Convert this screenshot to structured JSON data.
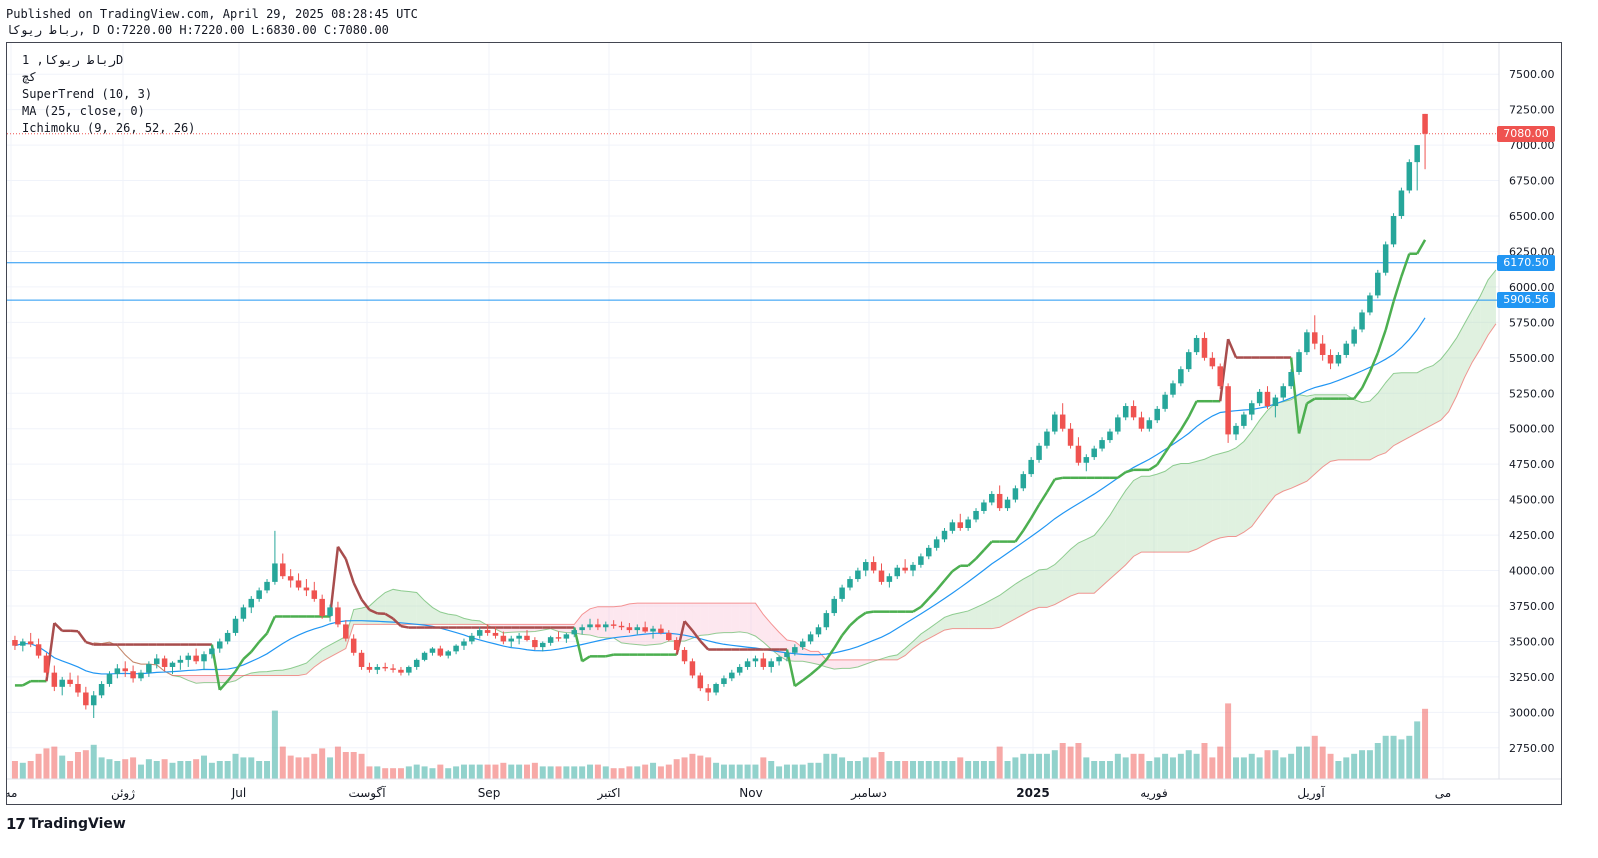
{
  "header": {
    "published": "Published on TradingView.com, April 29, 2025 08:28:45 UTC",
    "ohlc_line": "رباط ریوکا, D O:7220.00 H:7220.00 L:6830.00 C:7080.00"
  },
  "legend": {
    "symbol_line": "رباط ریوکا, 1D",
    "sub_symbol": "کچ",
    "indicator_1": "SuperTrend (10, 3)",
    "indicator_2": "MA (25, close, 0)",
    "indicator_3": "Ichimoku (9, 26, 52, 26)"
  },
  "price_tags": [
    {
      "label": "7080.00",
      "value": 7080,
      "color": "#ef5350"
    },
    {
      "label": "6170.50",
      "value": 6170.5,
      "color": "#2196f3"
    },
    {
      "label": "5906.56",
      "value": 5906.56,
      "color": "#2196f3"
    }
  ],
  "logo": {
    "mark": "17",
    "text": "TradingView"
  },
  "colors": {
    "up": "#26a69a",
    "down": "#ef5350",
    "supertrend_up": "#4caf50",
    "supertrend_down": "#a84d4d",
    "ma": "#2196f3",
    "cloud_green": "#a5d6a7",
    "cloud_red": "#f8bbd0",
    "hline": "#2196f3"
  },
  "chart_data": {
    "type": "candlestick",
    "y_axis_ticks": [
      "7500.00",
      "7250.00",
      "7000.00",
      "6750.00",
      "6500.00",
      "6250.00",
      "6000.00",
      "5750.00",
      "5500.00",
      "5250.00",
      "5000.00",
      "4750.00",
      "4500.00",
      "4250.00",
      "4000.00",
      "3750.00",
      "3500.00",
      "3250.00",
      "3000.00",
      "2750.00"
    ],
    "ylim": [
      2530,
      7720
    ],
    "x_axis_labels": [
      "مه",
      "ژوئن",
      "Jul",
      "آگوست",
      "Sep",
      "اکتبر",
      "Nov",
      "دسامبر",
      "2025",
      "فوریه",
      "آوریل",
      "می"
    ],
    "horizontal_lines": [
      6170.5,
      5906.56
    ],
    "last_close": 7080,
    "sessions": 180,
    "candles": [
      [
        3510,
        3540,
        3440,
        3470
      ],
      [
        3470,
        3520,
        3430,
        3500
      ],
      [
        3500,
        3560,
        3460,
        3480
      ],
      [
        3480,
        3520,
        3380,
        3400
      ],
      [
        3400,
        3420,
        3250,
        3280
      ],
      [
        3280,
        3330,
        3150,
        3180
      ],
      [
        3180,
        3250,
        3120,
        3230
      ],
      [
        3230,
        3280,
        3180,
        3200
      ],
      [
        3200,
        3260,
        3110,
        3140
      ],
      [
        3140,
        3180,
        3020,
        3050
      ],
      [
        3050,
        3150,
        2960,
        3120
      ],
      [
        3120,
        3220,
        3100,
        3200
      ],
      [
        3200,
        3290,
        3180,
        3270
      ],
      [
        3270,
        3340,
        3240,
        3310
      ],
      [
        3310,
        3360,
        3250,
        3290
      ],
      [
        3290,
        3330,
        3210,
        3240
      ],
      [
        3240,
        3300,
        3220,
        3280
      ],
      [
        3280,
        3360,
        3250,
        3340
      ],
      [
        3340,
        3410,
        3310,
        3380
      ],
      [
        3380,
        3400,
        3290,
        3320
      ],
      [
        3320,
        3360,
        3270,
        3350
      ],
      [
        3350,
        3400,
        3300,
        3370
      ],
      [
        3370,
        3420,
        3320,
        3400
      ],
      [
        3400,
        3450,
        3340,
        3360
      ],
      [
        3360,
        3430,
        3300,
        3410
      ],
      [
        3410,
        3470,
        3380,
        3450
      ],
      [
        3450,
        3520,
        3420,
        3500
      ],
      [
        3500,
        3580,
        3480,
        3560
      ],
      [
        3560,
        3680,
        3540,
        3660
      ],
      [
        3660,
        3760,
        3640,
        3740
      ],
      [
        3740,
        3820,
        3700,
        3800
      ],
      [
        3800,
        3880,
        3780,
        3860
      ],
      [
        3860,
        3940,
        3840,
        3920
      ],
      [
        3920,
        4280,
        3900,
        4050
      ],
      [
        4050,
        4120,
        3940,
        3960
      ],
      [
        3960,
        4010,
        3880,
        3930
      ],
      [
        3930,
        3980,
        3860,
        3880
      ],
      [
        3880,
        3940,
        3820,
        3860
      ],
      [
        3860,
        3920,
        3780,
        3800
      ],
      [
        3800,
        3830,
        3660,
        3680
      ],
      [
        3680,
        3760,
        3640,
        3740
      ],
      [
        3740,
        3780,
        3600,
        3620
      ],
      [
        3620,
        3650,
        3500,
        3520
      ],
      [
        3520,
        3550,
        3400,
        3420
      ],
      [
        3420,
        3440,
        3300,
        3320
      ],
      [
        3320,
        3350,
        3280,
        3300
      ],
      [
        3300,
        3340,
        3270,
        3320
      ],
      [
        3320,
        3350,
        3290,
        3310
      ],
      [
        3310,
        3340,
        3280,
        3300
      ],
      [
        3300,
        3320,
        3260,
        3280
      ],
      [
        3280,
        3330,
        3260,
        3320
      ],
      [
        3320,
        3380,
        3300,
        3370
      ],
      [
        3370,
        3430,
        3360,
        3420
      ],
      [
        3420,
        3460,
        3400,
        3450
      ],
      [
        3450,
        3470,
        3390,
        3400
      ],
      [
        3400,
        3440,
        3380,
        3430
      ],
      [
        3430,
        3480,
        3410,
        3470
      ],
      [
        3470,
        3520,
        3440,
        3500
      ],
      [
        3500,
        3560,
        3480,
        3540
      ],
      [
        3540,
        3600,
        3520,
        3580
      ],
      [
        3580,
        3620,
        3540,
        3560
      ],
      [
        3560,
        3600,
        3520,
        3540
      ],
      [
        3540,
        3570,
        3480,
        3500
      ],
      [
        3500,
        3540,
        3460,
        3520
      ],
      [
        3520,
        3560,
        3480,
        3540
      ],
      [
        3540,
        3580,
        3500,
        3510
      ],
      [
        3510,
        3530,
        3440,
        3460
      ],
      [
        3460,
        3500,
        3430,
        3490
      ],
      [
        3490,
        3540,
        3470,
        3530
      ],
      [
        3530,
        3570,
        3500,
        3520
      ],
      [
        3520,
        3560,
        3490,
        3550
      ],
      [
        3550,
        3600,
        3530,
        3580
      ],
      [
        3580,
        3620,
        3550,
        3600
      ],
      [
        3600,
        3660,
        3580,
        3620
      ],
      [
        3620,
        3660,
        3580,
        3600
      ],
      [
        3600,
        3640,
        3570,
        3620
      ],
      [
        3620,
        3650,
        3590,
        3610
      ],
      [
        3610,
        3640,
        3580,
        3600
      ],
      [
        3600,
        3630,
        3560,
        3580
      ],
      [
        3580,
        3620,
        3550,
        3600
      ],
      [
        3600,
        3640,
        3560,
        3570
      ],
      [
        3570,
        3610,
        3520,
        3590
      ],
      [
        3590,
        3620,
        3550,
        3560
      ],
      [
        3560,
        3580,
        3500,
        3510
      ],
      [
        3510,
        3530,
        3420,
        3440
      ],
      [
        3440,
        3460,
        3340,
        3360
      ],
      [
        3360,
        3380,
        3240,
        3260
      ],
      [
        3260,
        3280,
        3150,
        3170
      ],
      [
        3170,
        3200,
        3080,
        3140
      ],
      [
        3140,
        3210,
        3120,
        3200
      ],
      [
        3200,
        3260,
        3180,
        3240
      ],
      [
        3240,
        3300,
        3220,
        3280
      ],
      [
        3280,
        3340,
        3260,
        3320
      ],
      [
        3320,
        3380,
        3300,
        3360
      ],
      [
        3360,
        3400,
        3320,
        3380
      ],
      [
        3380,
        3420,
        3300,
        3320
      ],
      [
        3320,
        3380,
        3280,
        3360
      ],
      [
        3360,
        3400,
        3330,
        3390
      ],
      [
        3390,
        3440,
        3360,
        3420
      ],
      [
        3420,
        3480,
        3400,
        3460
      ],
      [
        3460,
        3520,
        3440,
        3500
      ],
      [
        3500,
        3570,
        3480,
        3550
      ],
      [
        3550,
        3620,
        3530,
        3600
      ],
      [
        3600,
        3720,
        3580,
        3700
      ],
      [
        3700,
        3820,
        3680,
        3800
      ],
      [
        3800,
        3900,
        3780,
        3880
      ],
      [
        3880,
        3960,
        3860,
        3940
      ],
      [
        3940,
        4020,
        3920,
        4000
      ],
      [
        4000,
        4080,
        3960,
        4060
      ],
      [
        4060,
        4100,
        3980,
        4000
      ],
      [
        4000,
        4050,
        3900,
        3920
      ],
      [
        3920,
        3980,
        3880,
        3960
      ],
      [
        3960,
        4040,
        3940,
        4020
      ],
      [
        4020,
        4080,
        3980,
        4000
      ],
      [
        4000,
        4060,
        3960,
        4040
      ],
      [
        4040,
        4120,
        4020,
        4100
      ],
      [
        4100,
        4180,
        4080,
        4160
      ],
      [
        4160,
        4240,
        4140,
        4220
      ],
      [
        4220,
        4300,
        4200,
        4280
      ],
      [
        4280,
        4360,
        4260,
        4340
      ],
      [
        4340,
        4400,
        4280,
        4300
      ],
      [
        4300,
        4380,
        4280,
        4360
      ],
      [
        4360,
        4440,
        4340,
        4420
      ],
      [
        4420,
        4500,
        4400,
        4480
      ],
      [
        4480,
        4560,
        4460,
        4540
      ],
      [
        4540,
        4600,
        4420,
        4440
      ],
      [
        4440,
        4520,
        4420,
        4500
      ],
      [
        4500,
        4600,
        4480,
        4580
      ],
      [
        4580,
        4700,
        4560,
        4680
      ],
      [
        4680,
        4800,
        4660,
        4780
      ],
      [
        4780,
        4900,
        4760,
        4880
      ],
      [
        4880,
        5000,
        4860,
        4980
      ],
      [
        4980,
        5120,
        4960,
        5100
      ],
      [
        5100,
        5180,
        4980,
        5000
      ],
      [
        5000,
        5040,
        4860,
        4880
      ],
      [
        4880,
        4940,
        4740,
        4760
      ],
      [
        4760,
        4820,
        4700,
        4800
      ],
      [
        4800,
        4880,
        4780,
        4860
      ],
      [
        4860,
        4940,
        4840,
        4920
      ],
      [
        4920,
        5000,
        4900,
        4980
      ],
      [
        4980,
        5100,
        4960,
        5080
      ],
      [
        5080,
        5180,
        5060,
        5160
      ],
      [
        5160,
        5200,
        5060,
        5080
      ],
      [
        5080,
        5120,
        4980,
        5000
      ],
      [
        5000,
        5080,
        4980,
        5060
      ],
      [
        5060,
        5160,
        5040,
        5140
      ],
      [
        5140,
        5260,
        5120,
        5240
      ],
      [
        5240,
        5340,
        5220,
        5320
      ],
      [
        5320,
        5440,
        5300,
        5420
      ],
      [
        5420,
        5560,
        5400,
        5540
      ],
      [
        5540,
        5660,
        5520,
        5640
      ],
      [
        5640,
        5680,
        5480,
        5500
      ],
      [
        5500,
        5540,
        5420,
        5440
      ],
      [
        5440,
        5460,
        5280,
        5300
      ],
      [
        5300,
        5320,
        4900,
        4960
      ],
      [
        4960,
        5040,
        4920,
        5020
      ],
      [
        5020,
        5120,
        5000,
        5100
      ],
      [
        5100,
        5200,
        5060,
        5180
      ],
      [
        5180,
        5280,
        5160,
        5260
      ],
      [
        5260,
        5300,
        5140,
        5160
      ],
      [
        5160,
        5240,
        5080,
        5220
      ],
      [
        5220,
        5320,
        5200,
        5300
      ],
      [
        5300,
        5420,
        5280,
        5400
      ],
      [
        5400,
        5560,
        5380,
        5540
      ],
      [
        5540,
        5700,
        5520,
        5680
      ],
      [
        5680,
        5800,
        5560,
        5600
      ],
      [
        5600,
        5660,
        5480,
        5520
      ],
      [
        5520,
        5560,
        5420,
        5460
      ],
      [
        5460,
        5540,
        5440,
        5520
      ],
      [
        5520,
        5620,
        5500,
        5600
      ],
      [
        5600,
        5720,
        5580,
        5700
      ],
      [
        5700,
        5840,
        5680,
        5820
      ],
      [
        5820,
        5960,
        5800,
        5940
      ],
      [
        5940,
        6120,
        5920,
        6100
      ],
      [
        6100,
        6320,
        6080,
        6300
      ],
      [
        6300,
        6520,
        6280,
        6500
      ],
      [
        6500,
        6700,
        6480,
        6680
      ],
      [
        6680,
        6900,
        6660,
        6880
      ],
      [
        6880,
        7000,
        6680,
        7000
      ],
      [
        7220,
        7220,
        6830,
        7080
      ]
    ]
  }
}
